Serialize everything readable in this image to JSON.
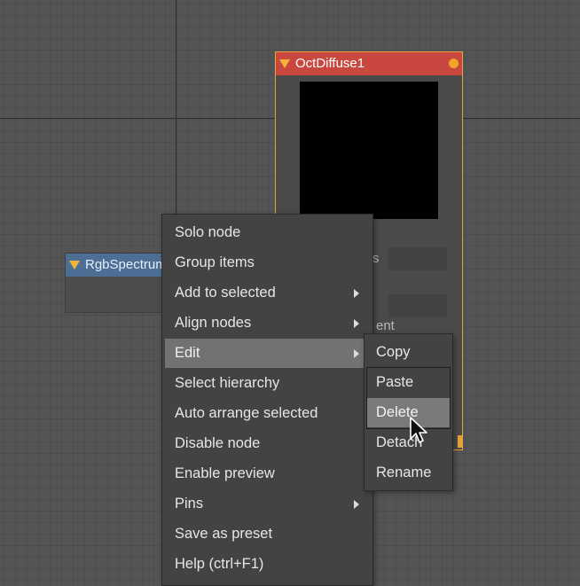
{
  "nodes": {
    "oct": {
      "title": "OctDiffuse1",
      "ghost_a": "s",
      "ghost_b": "ent"
    },
    "rgb": {
      "title": "RgbSpectrum"
    }
  },
  "context_menu": {
    "items": [
      {
        "label": "Solo node",
        "submenu": false
      },
      {
        "label": "Group items",
        "submenu": false
      },
      {
        "label": "Add to selected",
        "submenu": true
      },
      {
        "label": "Align nodes",
        "submenu": true
      },
      {
        "label": "Edit",
        "submenu": true,
        "highlighted": true
      },
      {
        "label": "Select hierarchy",
        "submenu": false
      },
      {
        "label": "Auto arrange selected",
        "submenu": false
      },
      {
        "label": "Disable node",
        "submenu": false
      },
      {
        "label": "Enable preview",
        "submenu": false
      },
      {
        "label": "Pins",
        "submenu": true
      },
      {
        "label": "Save as preset",
        "submenu": false
      },
      {
        "label": "Help (ctrl+F1)",
        "submenu": false
      }
    ]
  },
  "edit_submenu": {
    "items": [
      {
        "label": "Copy"
      },
      {
        "label": "Paste"
      },
      {
        "label": "Delete",
        "highlighted": true
      },
      {
        "label": "Detach"
      },
      {
        "label": "Rename"
      }
    ]
  },
  "colors": {
    "canvas": "#545454",
    "selected_node_border": "#e8a43a",
    "material_header": "#c8473e",
    "texture_header": "#4d6f96",
    "menu_bg": "#434343",
    "menu_highlight": "#727272"
  }
}
